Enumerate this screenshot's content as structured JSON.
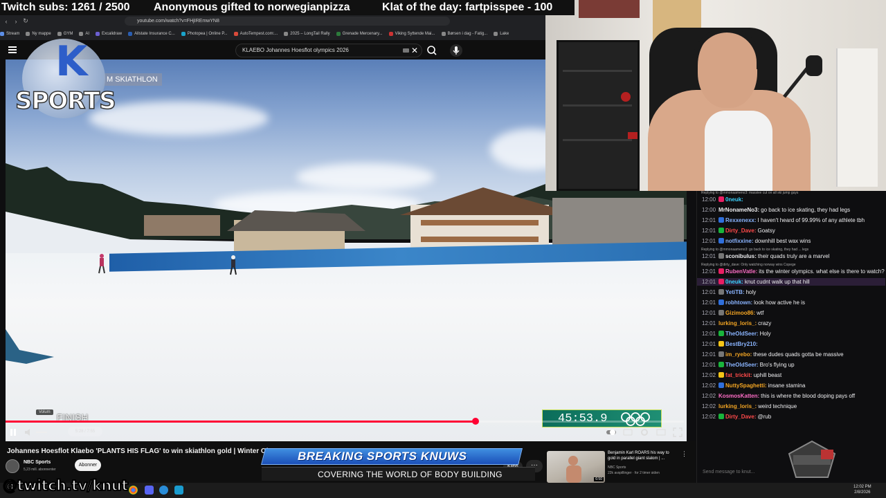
{
  "overlay": {
    "subs": "Twitch subs: 1261 / 2500",
    "gift": "Anonymous gifted to norwegianpizza",
    "klat": "Klat of the day: fartpisspee - 100",
    "twitch_url": "@twitch.tv/knut"
  },
  "browser": {
    "url": "youtube.com/watch?v=FHjIREmwYN8",
    "bookmarks": [
      {
        "label": "Stream",
        "color": "#5c8ee6"
      },
      {
        "label": "Ny mappe",
        "color": "#888"
      },
      {
        "label": "GYM",
        "color": "#888"
      },
      {
        "label": "AI",
        "color": "#888"
      },
      {
        "label": "Excalidraw",
        "color": "#6b5fd0"
      },
      {
        "label": "Allstate Insurance C...",
        "color": "#2a5db0"
      },
      {
        "label": "Photopea | Online P...",
        "color": "#1aa3c9"
      },
      {
        "label": "AutoTempest.com:...",
        "color": "#d84a3a"
      },
      {
        "label": "2025 – LongTail Rally",
        "color": "#888"
      },
      {
        "label": "Grenade Mercenary...",
        "color": "#2c7a3b"
      },
      {
        "label": "Viking Syttende Mai...",
        "color": "#c33"
      },
      {
        "label": "Børsen i dag - Fatig...",
        "color": "#888"
      },
      {
        "label": "Lake",
        "color": "#888"
      }
    ]
  },
  "youtube": {
    "search_query": "KLAEBO Johannes Hoesflot  olympics 2026",
    "video_title": "Johannes Hoesflot Klaebo 'PLANTS HIS FLAG' to win skiathlon gold | Winter Olympics 2026",
    "channel_name": "NBC Sports",
    "channel_subs": "5,23 mill. abonnenter",
    "subscribe_label": "Abonner",
    "clip_label": "Klipp",
    "more_label": "···",
    "time_display": "5:28 / 7:55",
    "volume_tooltip": "Volum",
    "progress_fraction": 0.693,
    "recommended": {
      "title": "Benjamin Karl ROARS his way to gold in parallel giant slalom | ...",
      "channel": "NBC Sports",
      "meta": "22k avspillinger · for 2 timer siden",
      "duration": "6:50"
    }
  },
  "video_overlay": {
    "brand_k": "K",
    "brand_sports": "SPORTS",
    "event_tag": "M SKIATHLON",
    "finish_label": "FINISH",
    "race_time": "45:53.9"
  },
  "news_banner": {
    "headline": "BREAKING SPORTS KNUWS",
    "subline": "COVERING THE WORLD OF BODY BUILDING"
  },
  "chat": {
    "input_placeholder": "Send message to knut...",
    "messages": [
      {
        "reply": "Replying to @mmonaameno3: massive cut on all ski jump guys",
        "time": "12:00",
        "user": "0neuk:",
        "color": "#3bd3ff",
        "text": "",
        "badge": "#e91e63"
      },
      {
        "reply": "",
        "time": "12:00",
        "user": "MrNonameNo3:",
        "color": "#efeff1",
        "text": "go back to ice skating, they had legs",
        "badge": ""
      },
      {
        "reply": "",
        "time": "12:01",
        "user": "Rexxenexx:",
        "color": "#8ab4ff",
        "text": "I haven't heard of 99.99% of any athlete tbh",
        "badge": "#2f6fdc"
      },
      {
        "reply": "",
        "time": "12:01",
        "user": "Dirty_Dave:",
        "color": "#ff4a4a",
        "text": "Goatsy",
        "badge": "#19b43c"
      },
      {
        "reply": "",
        "time": "12:01",
        "user": "notfixxine:",
        "color": "#8ab4ff",
        "text": "downhill best wax wins",
        "badge": "#2f6fdc"
      },
      {
        "reply": "Replying to @mmonaameno3: go back to ice skating, they had ... legs",
        "time": "12:01",
        "user": "sconibulus:",
        "color": "#efeff1",
        "text": "their quads truly are a marvel",
        "badge": "#777"
      },
      {
        "reply": "Replying to @dirty_dave: Only watching norway wins Copege",
        "time": "12:01",
        "user": "RubenVatle:",
        "color": "#ff6ec7",
        "text": "its the winter olympics. what else is there to watch?",
        "badge": "#e91e63"
      },
      {
        "reply": "",
        "time": "12:01",
        "user": "0neuk:",
        "color": "#3bd3ff",
        "text": "knut cudnt walk up that hill",
        "badge": "#e91e63",
        "hl": true
      },
      {
        "reply": "",
        "time": "12:01",
        "user": "YetiTB:",
        "color": "#8ab4ff",
        "text": "holy",
        "badge": "#777"
      },
      {
        "reply": "",
        "time": "12:01",
        "user": "robhtown:",
        "color": "#8ab4ff",
        "text": "look how active he is",
        "badge": "#2f6fdc"
      },
      {
        "reply": "",
        "time": "12:01",
        "user": "Gizimoo86:",
        "color": "#f5a623",
        "text": "wtf",
        "badge": "#777"
      },
      {
        "reply": "",
        "time": "12:01",
        "user": "lurking_loris_:",
        "color": "#f5a623",
        "text": "crazy",
        "badge": ""
      },
      {
        "reply": "",
        "time": "12:01",
        "user": "TheOldSeer:",
        "color": "#8ab4ff",
        "text": "Holy",
        "badge": "#19b43c"
      },
      {
        "reply": "",
        "time": "12:01",
        "user": "BestBry210:",
        "color": "#8ab4ff",
        "text": "",
        "badge": "#f5c518"
      },
      {
        "reply": "",
        "time": "12:01",
        "user": "im_ryebo:",
        "color": "#f5a623",
        "text": "these dudes quads gotta be massive",
        "badge": "#777"
      },
      {
        "reply": "",
        "time": "12:01",
        "user": "TheOldSeer:",
        "color": "#8ab4ff",
        "text": "Bro's flying up",
        "badge": "#19b43c"
      },
      {
        "reply": "",
        "time": "12:02",
        "user": "fat_trickit:",
        "color": "#ff4a4a",
        "text": "uphill beast",
        "badge": "#f5c518"
      },
      {
        "reply": "",
        "time": "12:02",
        "user": "NuttySpaghetti:",
        "color": "#f5a623",
        "text": "insane stamina",
        "badge": "#2f6fdc"
      },
      {
        "reply": "",
        "time": "12:02",
        "user": "KosmosKatten:",
        "color": "#ff6ec7",
        "text": "this is where the blood doping pays off",
        "badge": ""
      },
      {
        "reply": "",
        "time": "12:02",
        "user": "lurking_loris_:",
        "color": "#f5a623",
        "text": "weird technique",
        "badge": ""
      },
      {
        "reply": "",
        "time": "12:02",
        "user": "Dirty_Dave:",
        "color": "#ff4a4a",
        "text": "@rub",
        "badge": "#19b43c"
      }
    ]
  },
  "taskbar": {
    "time": "12:02 PM",
    "date": "2/8/2026"
  }
}
